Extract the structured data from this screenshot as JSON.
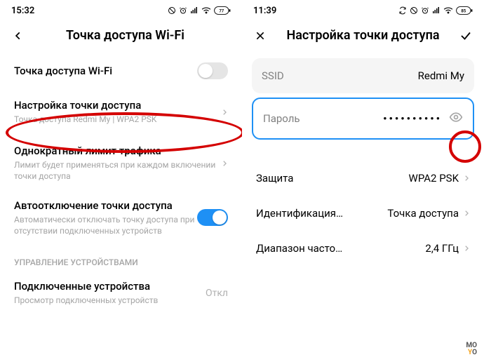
{
  "left": {
    "time": "15:32",
    "battery": "77",
    "title": "Точка доступа Wi-Fi",
    "rows": {
      "toggle": {
        "label": "Точка доступа Wi-Fi"
      },
      "configure": {
        "label": "Настройка точки доступа",
        "sub": "Точка доступа Redmi My | WPA2 PSK"
      },
      "limit": {
        "label": "Однократный лимит трафика",
        "sub": "Лимит будет применяться при каждом включении точки доступа"
      },
      "auto": {
        "label": "Автоотключение точки доступа",
        "sub": "Автоматически отключать точку доступа при отсутствии подключенных устройств"
      }
    },
    "section": "УПРАВЛЕНИЕ УСТРОЙСТВАМИ",
    "devices": {
      "label": "Подключенные устройства",
      "sub": "Просмотр подключенных устройств",
      "value": "Откл"
    }
  },
  "right": {
    "time": "11:39",
    "battery": "85",
    "title": "Настройка точки доступа",
    "ssid": {
      "label": "SSID",
      "value": "Redmi My"
    },
    "password": {
      "label": "Пароль",
      "dots": "••••••••••"
    },
    "security": {
      "label": "Защита",
      "value": "WPA2 PSK"
    },
    "ident": {
      "label": "Идентификация…",
      "value": "Точка доступа"
    },
    "band": {
      "label": "Диапазон часто…",
      "value": "2,4 ГГц"
    }
  },
  "logo": {
    "a": "MO",
    "b": "Y",
    "c": "O"
  }
}
